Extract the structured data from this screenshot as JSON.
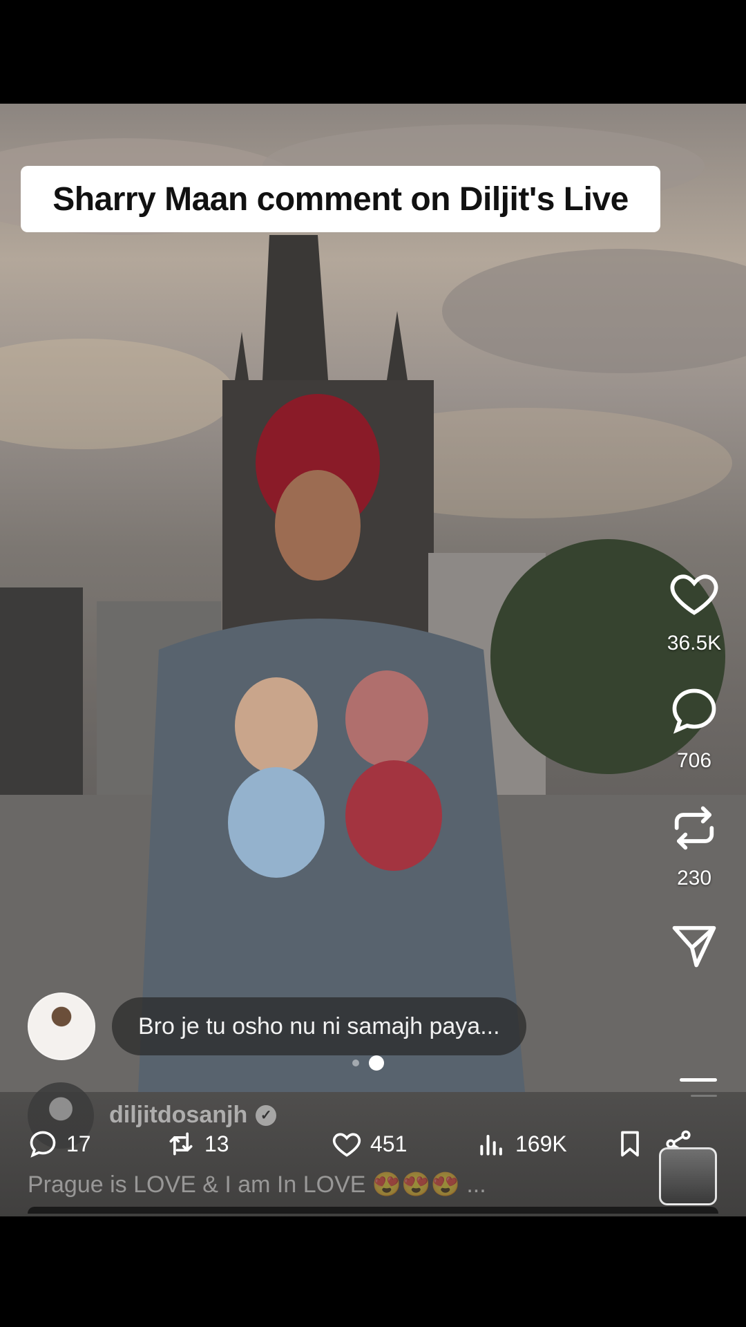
{
  "overlay_title": "Sharry Maan comment on Diljit's Live",
  "side_actions": {
    "likes": "36.5K",
    "comments": "706",
    "reposts": "230"
  },
  "live_comment": {
    "text": "Bro je tu osho nu ni samajh paya..."
  },
  "post": {
    "username": "diljitdosanjh",
    "replies": "17",
    "reposts": "13",
    "likes": "451",
    "views": "169K",
    "caption": "Prague is LOVE & I am In LOVE 😍😍😍 ..."
  },
  "icons": [
    "heart-icon",
    "comment-bubble-icon",
    "repost-icon",
    "send-icon",
    "reply-icon",
    "repost-arrows-icon",
    "like-icon",
    "views-bar-icon",
    "bookmark-icon",
    "share-icon",
    "verified-check-icon"
  ]
}
